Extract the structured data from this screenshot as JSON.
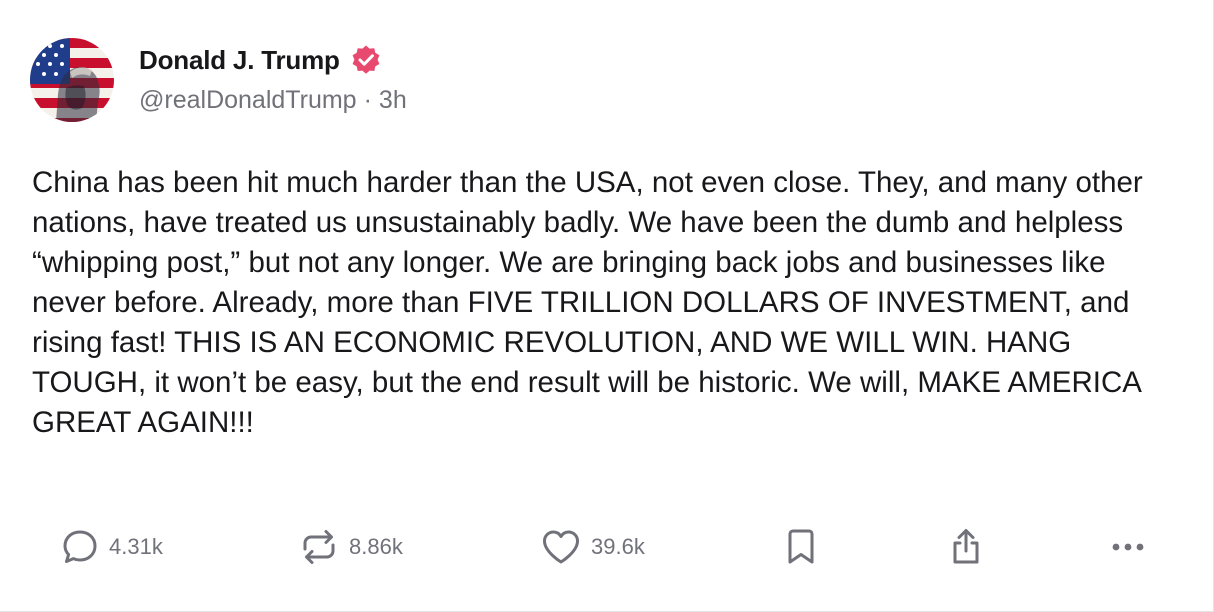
{
  "author": {
    "display_name": "Donald J. Trump",
    "handle": "@realDonaldTrump",
    "separator": "·",
    "time_ago": "3h",
    "verified": true
  },
  "post": {
    "text": "China has been hit much harder than the USA, not even close. They, and many other nations, have treated us unsustainably badly. We have been the dumb and helpless “whipping post,” but not any longer. We are bringing back jobs and businesses like never before. Already, more than FIVE TRILLION DOLLARS OF INVESTMENT, and rising fast! THIS IS AN ECONOMIC REVOLUTION, AND WE WILL WIN. HANG TOUGH, it won’t be easy, but the end result will be historic. We will, MAKE AMERICA GREAT AGAIN!!!"
  },
  "actions": {
    "replies": "4.31k",
    "reposts": "8.86k",
    "likes": "39.6k"
  },
  "icons": {
    "reply": "speech-bubble-icon",
    "repost": "repost-arrows-icon",
    "like": "heart-icon",
    "bookmark": "bookmark-icon",
    "share": "share-upload-icon",
    "more": "ellipsis-icon",
    "verified": "verified-badge-icon"
  },
  "colors": {
    "verified_badge": "#e84a6f",
    "text_primary": "#18181b",
    "text_secondary": "#71717a",
    "icon_gray": "#71717a"
  }
}
